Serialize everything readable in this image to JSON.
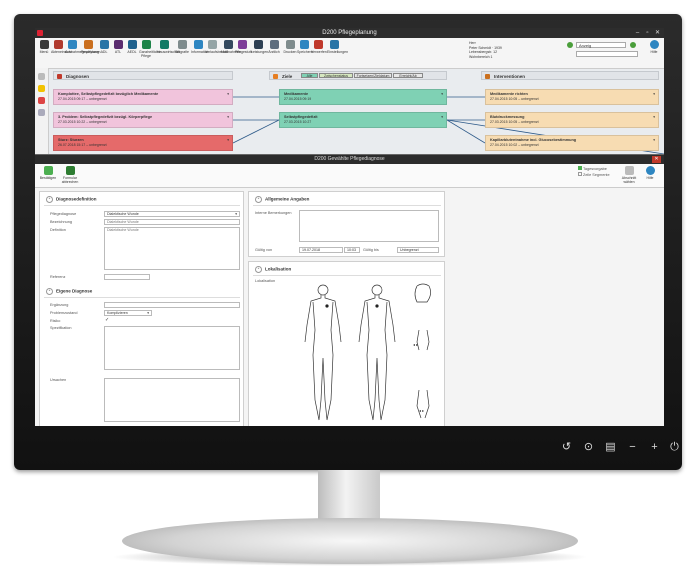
{
  "app": {
    "window_title": "D200 Pflegeplanung",
    "window_controls": [
      "–",
      "▫",
      "✕"
    ]
  },
  "ribbon": {
    "buttons": [
      {
        "label": "Menü",
        "icon": "menu-icon",
        "color": "#3a3a3a"
      },
      {
        "label": "Akteneinsicht",
        "icon": "files-icon",
        "color": "#b03a2e"
      },
      {
        "label": "Ausnahmegewährung",
        "icon": "user-icon",
        "color": "#2e86c1"
      },
      {
        "label": "Prophylaxen",
        "icon": "shield-icon",
        "color": "#ca6f1e"
      },
      {
        "label": "ADL",
        "icon": "person-icon",
        "color": "#2874a6"
      },
      {
        "label": "ATL",
        "icon": "person-icon",
        "color": "#5b2c6f"
      },
      {
        "label": "AEDL",
        "icon": "person-icon",
        "color": "#1f618d"
      },
      {
        "label": "Ganzheitliche Pflege",
        "icon": "heart-icon",
        "color": "#1e8449"
      },
      {
        "label": "Hauswirtschaft",
        "icon": "house-icon",
        "color": "#117a65"
      },
      {
        "label": "Biografie",
        "icon": "book-icon",
        "color": "#7f8c8d"
      },
      {
        "label": "Information",
        "icon": "info-icon",
        "color": "#2e86c1"
      },
      {
        "label": "Verlaufsbericht",
        "icon": "report-icon",
        "color": "#95a5a6"
      },
      {
        "label": "Maßnahmen",
        "icon": "list-icon",
        "color": "#34495e"
      },
      {
        "label": "Pflegestufe",
        "icon": "stairs-icon",
        "color": "#7d3c98"
      },
      {
        "label": "Leistungen",
        "icon": "coins-icon",
        "color": "#2e4053"
      },
      {
        "label": "Ärztlich",
        "icon": "stethoscope-icon",
        "color": "#5d6d7e"
      },
      {
        "label": "Drucken",
        "icon": "print-icon",
        "color": "#7f8c8d"
      },
      {
        "label": "Speichern",
        "icon": "save-icon",
        "color": "#2e86c1"
      },
      {
        "label": "Verwerfen",
        "icon": "delete-icon",
        "color": "#c0392b"
      },
      {
        "label": "Einstellungen",
        "icon": "settings-icon",
        "color": "#2874a6"
      }
    ],
    "patient_lines": [
      "Herr",
      "Peter Schmidt · 1939",
      "Lebensbergstr. 12",
      "Wohnbereich 1"
    ],
    "search_value": "Anzeig",
    "help_label": "Hilfe"
  },
  "columns": {
    "diagnosen": "Diagnosen",
    "ziele": "Ziele",
    "interventionen": "Interventionen"
  },
  "goal_pills": [
    "Alle",
    "Zwischenstatus",
    "Fortsetzen/Zieldatum",
    "Erreicht/Ab"
  ],
  "diagnosen_cards": [
    {
      "title": "Komplottee, Selbstpflegedefizit bezüglich Medikamente",
      "sub": "27.04.2015 09:17 – unbegrenzt",
      "color": "#f1c4dc"
    },
    {
      "title": "3. Problem: Selbstpflegedefizit bezügl. Körperpflege",
      "sub": "27.03.2015 10:22 – unbegrenzt",
      "color": "#f1c4dc"
    },
    {
      "title": "Sturz: Sturzen",
      "sub": "26.07.2018 15:17 – unbegrenzt",
      "color": "#e56a6a"
    }
  ],
  "ziele_cards": [
    {
      "title": "Medikamente",
      "sub": "27.04.2015 09:19",
      "color": "#7fd1b4"
    },
    {
      "title": "Selbstpflegedefizit",
      "sub": "27.03.2015 10:27",
      "color": "#7fd1b4"
    }
  ],
  "interventionen_cards": [
    {
      "title": "Medikamente richten",
      "sub": "27.04.2015 10:05 – unbegrenzt",
      "color": "#f7dcb2"
    },
    {
      "title": "Blutdruckmessung",
      "sub": "27.03.2015 10:05 – unbegrenzt",
      "color": "#f7dcb2"
    },
    {
      "title": "Kapillarblutentnahme incl. Glucosebestimmung",
      "sub": "27.04.2015 10:02 – unbegrenzt",
      "color": "#f7dcb2"
    }
  ],
  "dialog": {
    "title": "D200 Gewählte Pflegediagnose",
    "toolbar": {
      "save": "Bestätigen",
      "cancel": "Formular abbrechen"
    },
    "toolbar_right": {
      "flag1": "Tagesvorgabe",
      "flag2": "Zeile Segmente",
      "apply": "Abschnitt wählen",
      "help": "Hilfe"
    },
    "sect_diag": "Diagnosedefinition",
    "diag_fields": {
      "nursing_label": "Pflegediagnose",
      "nursing_value": "Dialektische Wunde",
      "name_label": "Bezeichnung",
      "name_value": "Dialektische Wunde",
      "def_label": "Definition",
      "def_value": "Dialektische Wunde",
      "ref_label": "Referenz"
    },
    "sect_own": "Eigene Diagnose",
    "own_fields": {
      "addition_label": "Ergänzung",
      "problem_label": "Problemzustand",
      "problem_value": "Komplizieren",
      "risk_label": "Risiko",
      "spec_label": "Spezifikation",
      "cause_label": "Ursachen"
    },
    "sect_general": "Allgemeine Angaben",
    "general_fields": {
      "notes_label": "Interne Bemerkungen",
      "valid_from_label": "Gültig von",
      "valid_from_value": "19.07.2018",
      "time_value": "10:03",
      "valid_to_label": "Gültig bis",
      "valid_to_value": "Unbegrenzt"
    },
    "sect_local": "Lokalisation",
    "local_label": "Lokalisation"
  },
  "monitor_buttons": [
    "↺",
    "⊙",
    "▤",
    "−",
    "+",
    "⏻"
  ]
}
